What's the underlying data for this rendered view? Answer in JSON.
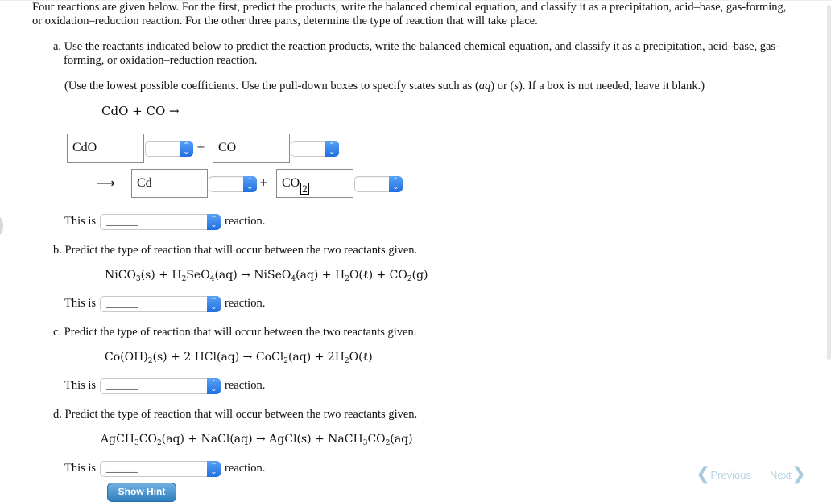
{
  "intro": "Four reactions are given below. For the first, predict the products, write the balanced chemical equation, and classify it as a precipitation, acid–base, gas-forming, or oxidation–reduction reaction. For the other three parts, determine the type of reaction that will take place.",
  "part_a": {
    "prompt": "a. Use the reactants indicated below to predict the reaction products, write the balanced chemical equation, and classify it as a precipitation, acid–base, gas-forming, or oxidation–reduction reaction.",
    "instructions_before": "(Use the lowest possible coefficients. Use the pull-down boxes to specify states such as (",
    "state_aq": "aq",
    "instructions_mid": ") or (",
    "state_s": "s",
    "instructions_after": "). If a box is not needed, leave it blank.)",
    "equation": "CdO + CO →",
    "reactant1": "CdO",
    "reactant2": "CO",
    "product1": "Cd",
    "product2_base": "CO",
    "product2_subscript": "2",
    "plus": "+",
    "arrow": "⟶",
    "this_is": "This is",
    "select_placeholder": "______",
    "reaction_suffix": "reaction."
  },
  "part_b": {
    "prompt": "b. Predict the type of reaction that will occur between the two reactants given.",
    "equation_html": "NiCO<sub>3</sub>(s) + H<sub>2</sub>SeO<sub>4</sub>(aq) → NiSeO<sub>4</sub>(aq) + H<sub>2</sub>O(ℓ) + CO<sub>2</sub>(g)",
    "this_is": "This is",
    "select_placeholder": "______",
    "reaction_suffix": "reaction."
  },
  "part_c": {
    "prompt": "c. Predict the type of reaction that will occur between the two reactants given.",
    "equation_html": "Co(OH)<sub>2</sub>(s) + 2 HCl(aq) → CoCl<sub>2</sub>(aq) + 2H<sub>2</sub>O(ℓ)",
    "this_is": "This is",
    "select_placeholder": "______",
    "reaction_suffix": "reaction."
  },
  "part_d": {
    "prompt": "d. Predict the type of reaction that will occur between the two reactants given.",
    "equation_html": "AgCH<sub>3</sub>CO<sub>2</sub>(aq) + NaCl(aq) → AgCl(s) + NaCH<sub>3</sub>CO<sub>2</sub>(aq)",
    "this_is": "This is",
    "select_placeholder": "______",
    "reaction_suffix": "reaction."
  },
  "buttons": {
    "show_hint": "Show Hint",
    "previous": "Previous",
    "next": "Next",
    "prev_icon": "❮",
    "next_icon": "❯"
  },
  "icons": {
    "select_arrows": "⌃⌄"
  }
}
